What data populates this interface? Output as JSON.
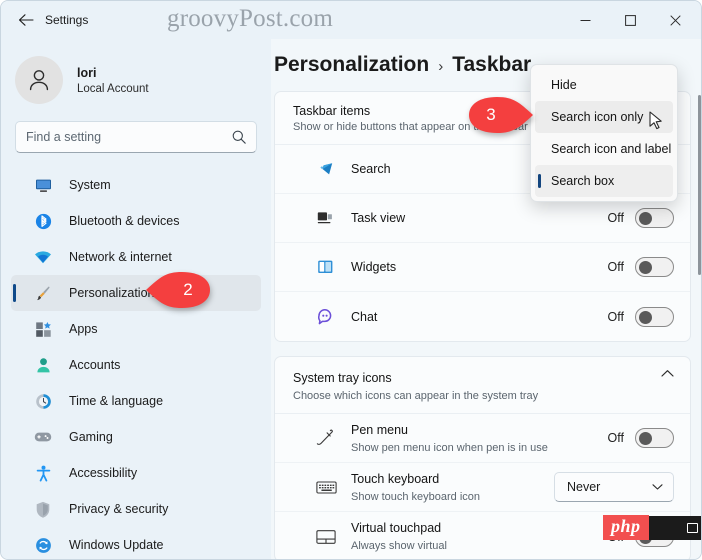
{
  "window": {
    "title": "Settings",
    "watermark": "groovyPost.com",
    "controls": {
      "minimize": "minimize",
      "maximize": "maximize",
      "close": "close"
    },
    "back_label": "Back"
  },
  "sidebar": {
    "profile": {
      "name": "lori",
      "account_type": "Local Account"
    },
    "search": {
      "placeholder": "Find a setting",
      "value": ""
    },
    "items": [
      {
        "label": "System",
        "icon": "monitor-icon",
        "selected": false
      },
      {
        "label": "Bluetooth & devices",
        "icon": "bluetooth-icon",
        "selected": false
      },
      {
        "label": "Network & internet",
        "icon": "wifi-icon",
        "selected": false
      },
      {
        "label": "Personalization",
        "icon": "paintbrush-icon",
        "selected": true
      },
      {
        "label": "Apps",
        "icon": "apps-icon",
        "selected": false
      },
      {
        "label": "Accounts",
        "icon": "person-icon",
        "selected": false
      },
      {
        "label": "Time & language",
        "icon": "clock-icon",
        "selected": false
      },
      {
        "label": "Gaming",
        "icon": "gamepad-icon",
        "selected": false
      },
      {
        "label": "Accessibility",
        "icon": "accessibility-icon",
        "selected": false
      },
      {
        "label": "Privacy & security",
        "icon": "shield-icon",
        "selected": false
      },
      {
        "label": "Windows Update",
        "icon": "update-icon",
        "selected": false
      }
    ]
  },
  "main": {
    "breadcrumb": {
      "parent": "Personalization",
      "separator": "›",
      "current": "Taskbar"
    },
    "taskbar_items_card": {
      "title": "Taskbar items",
      "subtitle": "Show or hide buttons that appear on the taskbar",
      "rows": [
        {
          "label": "Search",
          "icon": "search-taskbar-icon",
          "control": "dropdown",
          "state": ""
        },
        {
          "label": "Task view",
          "icon": "taskview-icon",
          "control": "toggle",
          "state": "Off"
        },
        {
          "label": "Widgets",
          "icon": "widgets-icon",
          "control": "toggle",
          "state": "Off"
        },
        {
          "label": "Chat",
          "icon": "chat-icon",
          "control": "toggle",
          "state": "Off"
        }
      ]
    },
    "system_tray_card": {
      "title": "System tray icons",
      "subtitle": "Choose which icons can appear in the system tray",
      "expand_icon": "chevron-up-icon",
      "rows": [
        {
          "label": "Pen menu",
          "sub": "Show pen menu icon when pen is in use",
          "icon": "pen-icon",
          "control": "toggle",
          "state": "Off"
        },
        {
          "label": "Touch keyboard",
          "sub": "Show touch keyboard icon",
          "icon": "keyboard-icon",
          "control": "select",
          "state": "Never"
        },
        {
          "label": "Virtual touchpad",
          "sub": "Always show virtual",
          "icon": "touchpad-icon",
          "control": "toggle",
          "state": "Off"
        }
      ]
    }
  },
  "flyout": {
    "items": [
      {
        "label": "Hide",
        "hovered": false,
        "selected": false
      },
      {
        "label": "Search icon only",
        "hovered": true,
        "selected": false
      },
      {
        "label": "Search icon and label",
        "hovered": false,
        "selected": false
      },
      {
        "label": "Search box",
        "hovered": false,
        "selected": true
      }
    ]
  },
  "callouts": [
    {
      "number": "2",
      "direction": "left",
      "target": "sidebar-item-personalization"
    },
    {
      "number": "3",
      "direction": "right",
      "target": "flyout-item-search-icon-only"
    }
  ],
  "watermark_php": {
    "text": "php"
  },
  "colors": {
    "window_bg": "#eaf2f8",
    "content_bg": "#f2f7fa",
    "card_bg": "#fafcfd",
    "accent_blue": "#0f4a8a",
    "callout_red": "#f43f3f",
    "php_red": "#f24f4f"
  }
}
